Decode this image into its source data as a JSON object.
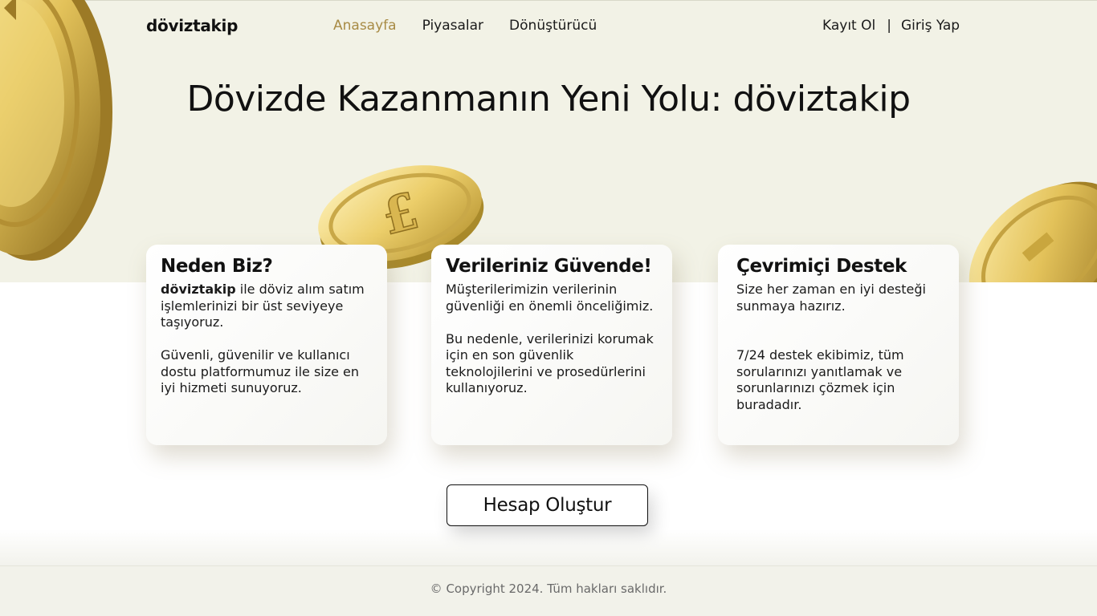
{
  "header": {
    "brand": "döviztakip",
    "nav": [
      "Anasayfa",
      "Piyasalar",
      "Dönüştürücü"
    ],
    "auth": {
      "register": "Kayıt Ol",
      "separator": "|",
      "login": "Giriş Yap"
    }
  },
  "hero": {
    "title": "Dövizde Kazanmanın Yeni Yolu: döviztakip"
  },
  "cards": [
    {
      "title": "Neden Biz?",
      "p1_bold": "döviztakip",
      "p1_rest": " ile döviz alım satım işlemlerinizi bir üst seviyeye taşıyoruz.",
      "p2": "Güvenli, güvenilir ve kullanıcı dostu platformumuz ile size en iyi hizmeti sunuyoruz."
    },
    {
      "title": "Verileriniz Güvende!",
      "p1": "Müşterilerimizin verilerinin güvenliği en önemli önceliğimiz.",
      "p2": "Bu nedenle, verilerinizi korumak için en son güvenlik teknolojilerini ve prosedürlerini kullanıyoruz."
    },
    {
      "title": "Çevrimiçi Destek",
      "p1": "Size her zaman en iyi desteği sunmaya hazırız.",
      "p2": "7/24 destek ekibimiz, tüm sorularınızı yanıtlamak ve sorunlarınızı çözmek için buradadır."
    }
  ],
  "cta": {
    "label": "Hesap Oluştur"
  },
  "footer": {
    "copyright": "© Copyright 2024. Tüm hakları saklıdır."
  },
  "colors": {
    "hero_bg": "#f2f2e6",
    "accent": "#a88b45",
    "coin_gold": "#e3c25a",
    "footer_bg": "#f2f2ea"
  },
  "icons": [
    "gold-coin-icon",
    "pound-coin-icon"
  ]
}
